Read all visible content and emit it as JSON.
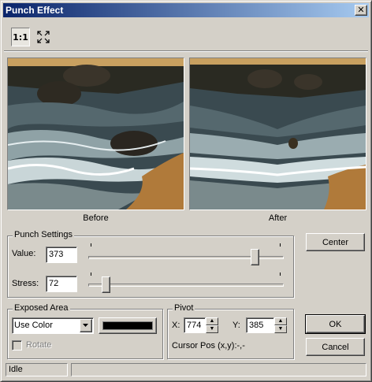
{
  "window": {
    "title": "Punch Effect",
    "close_glyph": "✕"
  },
  "toolbar": {
    "zoom_1to1_label": "1:1",
    "fit_icon": "fit-to-window-icon"
  },
  "previews": {
    "before_label": "Before",
    "after_label": "After"
  },
  "punch_settings": {
    "group_label": "Punch Settings",
    "value_label": "Value:",
    "value": "373",
    "value_slider_level": 0.87,
    "stress_label": "Stress:",
    "stress": "72",
    "stress_slider_level": 0.07
  },
  "exposed_area": {
    "group_label": "Exposed Area",
    "mode_selected": "Use Color",
    "color_swatch": "#000000",
    "rotate_label": "Rotate",
    "rotate_checked": false
  },
  "pivot": {
    "group_label": "Pivot",
    "x_label": "X:",
    "x_value": "774",
    "y_label": "Y:",
    "y_value": "385",
    "cursor_pos": "Cursor Pos (x,y):-,-"
  },
  "buttons": {
    "center": "Center",
    "ok": "OK",
    "cancel": "Cancel"
  },
  "status": {
    "text": "Idle"
  },
  "colors": {
    "title_gradient_start": "#0a246a",
    "title_gradient_end": "#a6caf0",
    "face": "#d4d0c8"
  }
}
